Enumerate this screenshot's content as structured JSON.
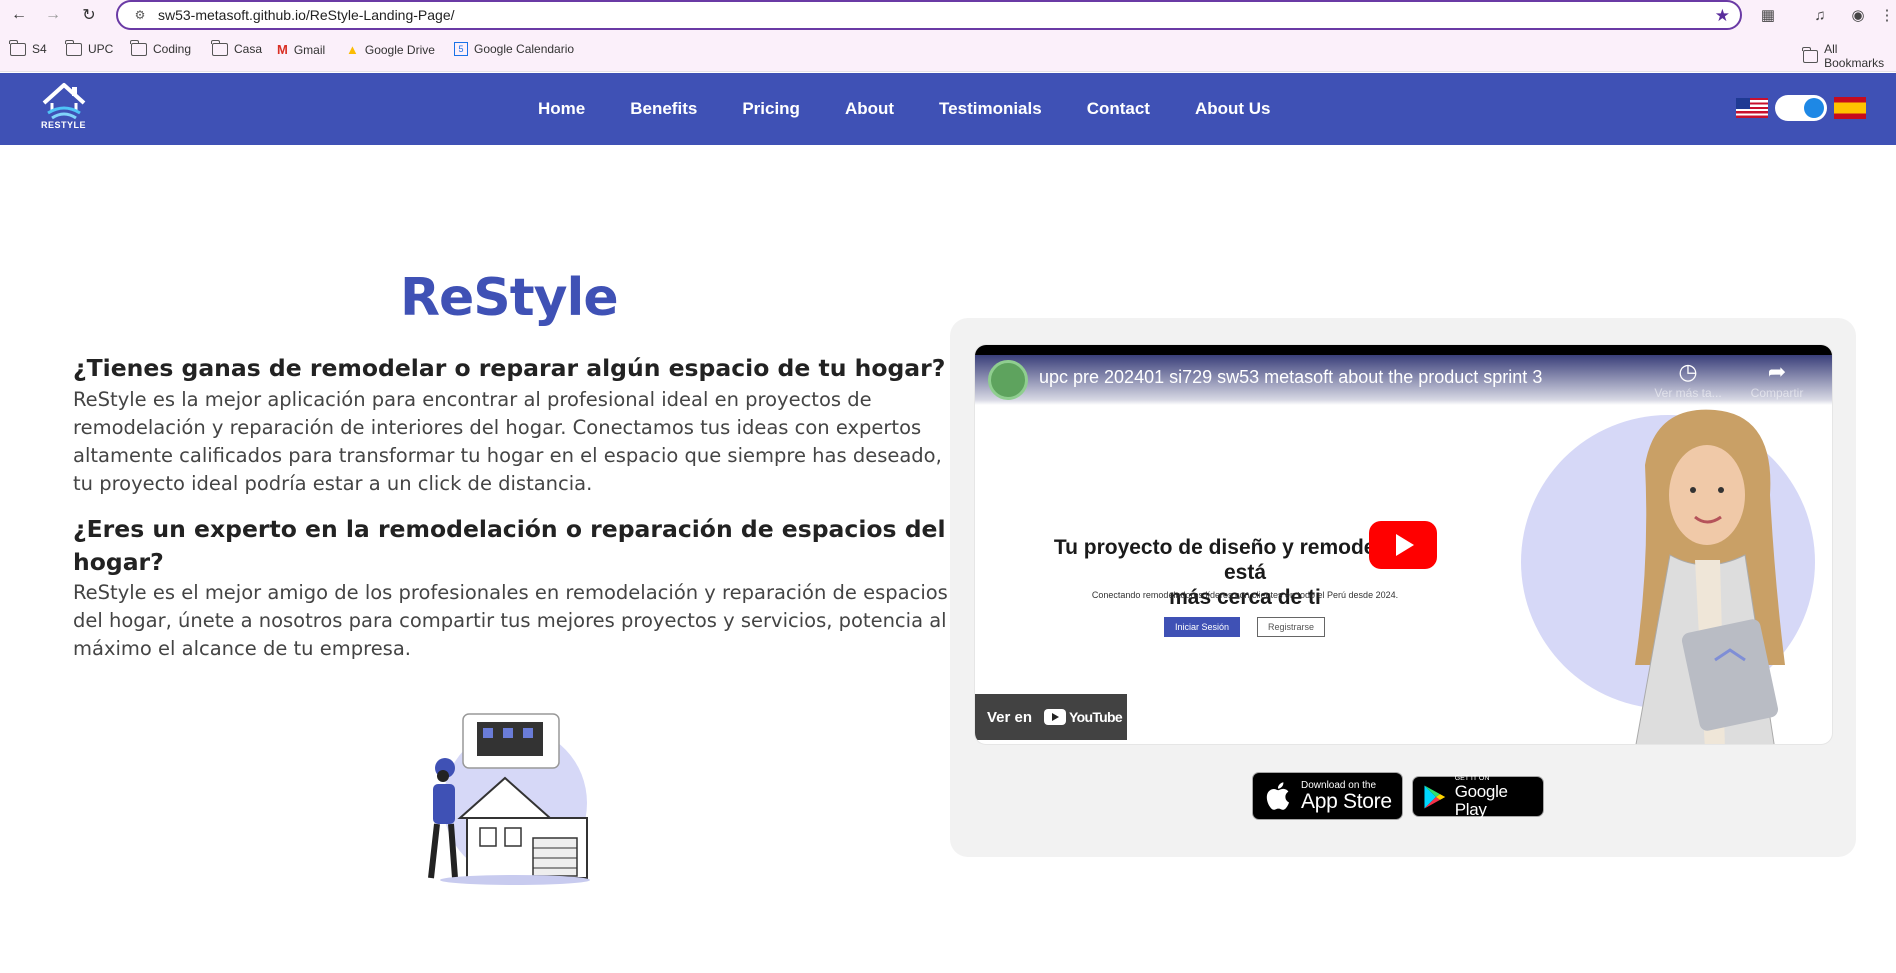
{
  "browser": {
    "url": "sw53-metasoft.github.io/ReStyle-Landing-Page/",
    "bookmarks": [
      "S4",
      "UPC",
      "Coding",
      "Casa",
      "Gmail",
      "Google Drive",
      "Google Calendario"
    ],
    "all_bookmarks": "All Bookmarks"
  },
  "header": {
    "logo_text": "RESTYLE",
    "nav": [
      "Home",
      "Benefits",
      "Pricing",
      "About",
      "Testimonials",
      "Contact",
      "About Us"
    ]
  },
  "hero": {
    "title": "ReStyle",
    "q1": "¿Tienes ganas de remodelar o reparar algún espacio de tu hogar?",
    "p1": "ReStyle es la mejor aplicación para encontrar al profesional ideal en proyectos de remodelación y reparación de interiores del hogar. Conectamos tus ideas con expertos altamente calificados para transformar tu hogar en el espacio que siempre has deseado, tu proyecto ideal podría estar a un click de distancia.",
    "q2_line1": "¿Eres un experto en la remodelación o reparación de espacios del",
    "q2_line2": "hogar?",
    "p2": "ReStyle es el mejor amigo de los profesionales en remodelación y reparación de espacios del hogar, únete a nosotros para compartir tus mejores proyectos y servicios, potencia al máximo el alcance de tu empresa."
  },
  "video": {
    "title": "upc pre 202401 si729 sw53 metasoft about the product sprint 3",
    "watch_later": "Ver más ta...",
    "share": "Compartir",
    "headline_line1": "Tu proyecto de diseño y remodelación está",
    "headline_line2": "más cerca de ti",
    "subtext": "Conectando remodeladores líderes con clientes en todo el Perú desde 2024.",
    "login": "Iniciar Sesión",
    "register": "Registrarse",
    "watch_on": "Ver en",
    "youtube": "YouTube"
  },
  "stores": {
    "apple_small": "Download on the",
    "apple_big": "App Store",
    "google_small": "GET IT ON",
    "google_big": "Google Play"
  },
  "colors": {
    "brand": "#3f51b5",
    "youtube_red": "#ff0000"
  }
}
